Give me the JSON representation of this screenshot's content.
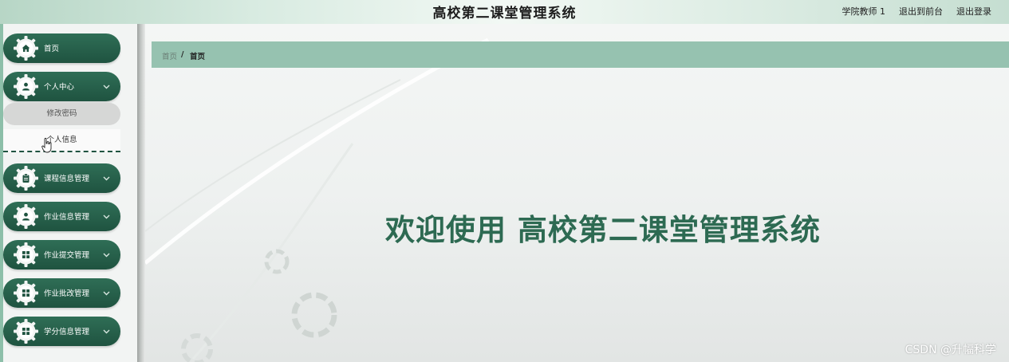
{
  "header": {
    "title": "高校第二课堂管理系统",
    "user": "学院教师 1",
    "to_front": "退出到前台",
    "logout": "退出登录"
  },
  "sidebar": {
    "items": [
      {
        "label": "首页",
        "icon": "home-icon"
      },
      {
        "label": "个人中心",
        "icon": "user-icon",
        "expanded": true
      },
      {
        "label": "课程信息管理",
        "icon": "clipboard-icon"
      },
      {
        "label": "作业信息管理",
        "icon": "user-icon"
      },
      {
        "label": "作业提交管理",
        "icon": "grid-icon"
      },
      {
        "label": "作业批改管理",
        "icon": "grid-icon"
      },
      {
        "label": "学分信息管理",
        "icon": "grid-icon"
      }
    ],
    "sub_items": [
      {
        "label": "修改密码"
      },
      {
        "label": "个人信息"
      }
    ]
  },
  "breadcrumb": {
    "home": "首页",
    "separator": "/",
    "current": "首页"
  },
  "main": {
    "welcome": "欢迎使用 高校第二课堂管理系统"
  },
  "watermark": "CSDN @升幅科学",
  "colors": {
    "menu_bg": "#1f5340",
    "breadcrumb_bg": "#96c2b0",
    "welcome_text": "#2d6a52"
  }
}
